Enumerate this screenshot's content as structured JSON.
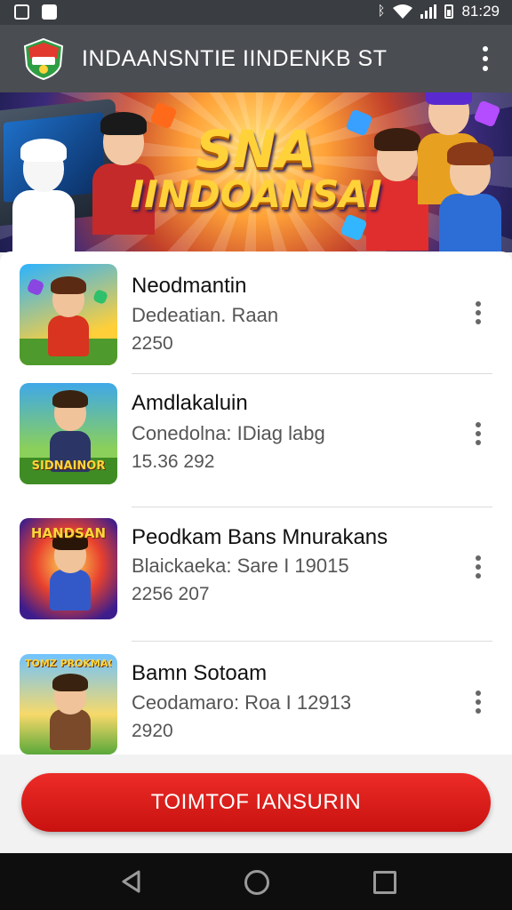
{
  "status_bar": {
    "time": "81:29",
    "icons": [
      "image-icon",
      "square-icon",
      "bluetooth-icon",
      "wifi-icon",
      "signal-icon",
      "battery-icon"
    ]
  },
  "app_bar": {
    "title": "INDAANSNTIE IINDENKB ST",
    "logo_icon": "app-logo-icon",
    "menu_icon": "more-vertical-icon"
  },
  "banner": {
    "line1": "SNA",
    "line2": "IINDOANSAI"
  },
  "games": [
    {
      "title": "Neodmantin",
      "subtitle": "Dedeatian. Raan",
      "meta": "2250"
    },
    {
      "title": "Amdlakaluin",
      "subtitle": "Conedolna: IDiag labg",
      "meta": "15.36 292"
    },
    {
      "title": "Peodkam Bans Mnurakans",
      "subtitle": "Blaickaeka: Sare I 19015",
      "meta": "2256  207"
    },
    {
      "title": "Bamn Sotoam",
      "subtitle": "Ceodamaro: Roa I 12913",
      "meta": "2920"
    }
  ],
  "thumb_labels": [
    "",
    "SIDNAINOR",
    "HANDSAN",
    "TOMZ PROKMAGOR"
  ],
  "cta": {
    "label": "TOIMTOF IANSURIN"
  },
  "nav": {
    "back_icon": "back-icon",
    "home_icon": "home-icon",
    "recents_icon": "recents-icon"
  },
  "colors": {
    "app_bar": "#4a4d52",
    "status_bar": "#3a3d41",
    "accent": "#d81b17",
    "nav_bar": "#0e0e0e"
  }
}
